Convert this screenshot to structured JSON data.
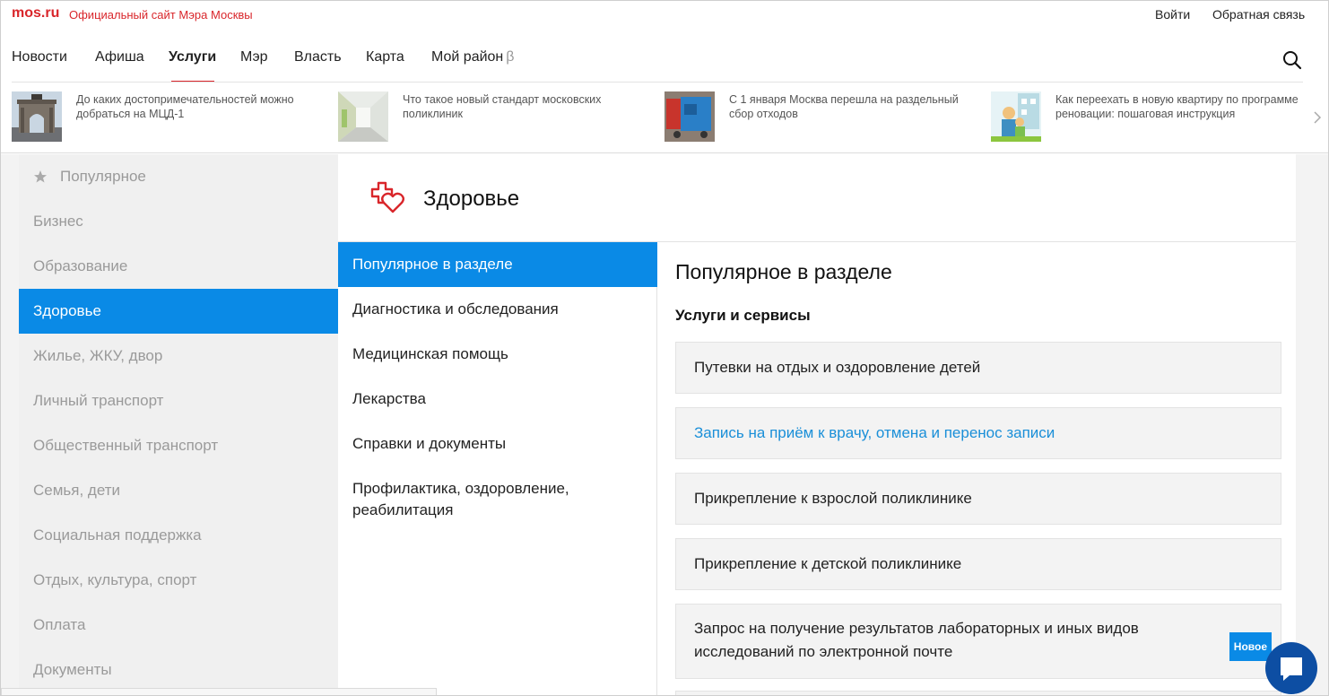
{
  "header": {
    "logo": "mos.ru",
    "tagline": "Официальный сайт Мэра Москвы",
    "login": "Войти",
    "feedback": "Обратная связь"
  },
  "nav": {
    "items": [
      "Новости",
      "Афиша",
      "Услуги",
      "Мэр",
      "Власть",
      "Карта",
      "Мой район"
    ],
    "beta": "β",
    "active": "Услуги"
  },
  "news": [
    {
      "text": "До каких достопримечательностей можно добраться на МЦД-1"
    },
    {
      "text": "Что такое новый стандарт московских поликлиник"
    },
    {
      "text": "С 1 января Москва перешла на раздельный сбор отходов"
    },
    {
      "text": "Как переехать в новую квартиру по программе реновации: пошаговая инструкция"
    }
  ],
  "categories": [
    "Популярное",
    "Бизнес",
    "Образование",
    "Здоровье",
    "Жилье, ЖКУ, двор",
    "Личный транспорт",
    "Общественный транспорт",
    "Семья, дети",
    "Социальная поддержка",
    "Отдых, культура, спорт",
    "Оплата",
    "Документы"
  ],
  "section": {
    "title": "Здоровье",
    "subnav": [
      "Популярное в разделе",
      "Диагностика и обследования",
      "Медицинская помощь",
      "Лекарства",
      "Справки и документы",
      "Профилактика, оздоровление, реабилитация"
    ]
  },
  "services": {
    "title": "Популярное в разделе",
    "subtitle": "Услуги и сервисы",
    "items": [
      {
        "label": "Путевки на отдых и оздоровление детей"
      },
      {
        "label": "Запись на приём к врачу, отмена и перенос записи"
      },
      {
        "label": "Прикрепление к взрослой поликлинике"
      },
      {
        "label": "Прикрепление к детской поликлинике"
      },
      {
        "label": "Запрос на получение результатов лабораторных и иных видов исследований по электронной почте",
        "badge": "Новое"
      }
    ]
  },
  "colors": {
    "brand": "#d9262b",
    "accent": "#0a8ae6",
    "link": "#1a8fd8",
    "chat": "#0d4ea3"
  }
}
